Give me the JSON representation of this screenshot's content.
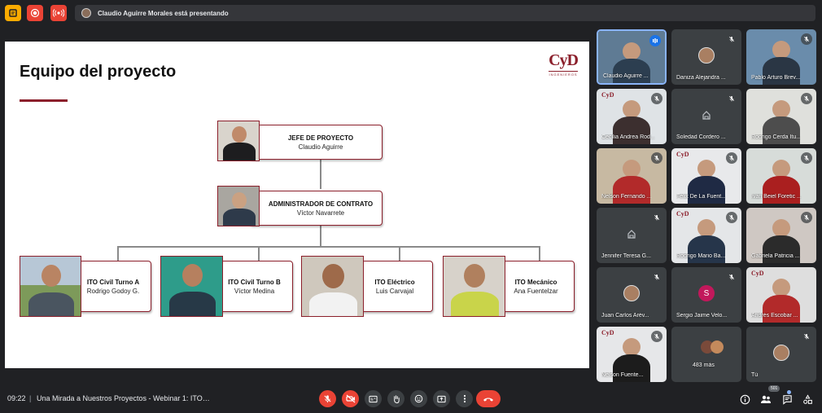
{
  "top_bar": {
    "presenting_text": "Claudio Aguirre Morales está presentando",
    "colors": {
      "hand": "#f9ab00",
      "record": "#ea4335",
      "live": "#ea4335"
    }
  },
  "slide": {
    "title": "Equipo del proyecto",
    "logo": "CyD",
    "logo_sub": "INGENIEROS",
    "accent_color": "#8b1f2b",
    "org": {
      "head": {
        "role": "JEFE DE PROYECTO",
        "name": "Claudio Aguirre"
      },
      "admin": {
        "role": "ADMINISTRADOR DE CONTRATO",
        "name": "Víctor Navarrete"
      },
      "members": [
        {
          "role": "ITO Civil Turno A",
          "name": "Rodrigo Godoy G."
        },
        {
          "role": "ITO Civil Turno B",
          "name": "Víctor Medina"
        },
        {
          "role": "ITO Eléctrico",
          "name": "Luis Carvajal"
        },
        {
          "role": "ITO Mecánico",
          "name": "Ana Fuentelzar"
        }
      ]
    }
  },
  "participants": [
    {
      "name": "Claudio Aguirre ...",
      "mic": "speaking",
      "kind": "video"
    },
    {
      "name": "Daniza Alejandra ...",
      "mic": "muted",
      "kind": "photo"
    },
    {
      "name": "Pablo Arturo Brev...",
      "mic": "muted",
      "kind": "video"
    },
    {
      "name": "Cecilia Andrea Rod...",
      "mic": "muted",
      "kind": "video"
    },
    {
      "name": "Soledad Cordero ...",
      "mic": "muted",
      "kind": "camera-off"
    },
    {
      "name": "Rodrigo Cerda Itu...",
      "mic": "muted",
      "kind": "video"
    },
    {
      "name": "Nelson Fernando ...",
      "mic": "muted",
      "kind": "video"
    },
    {
      "name": "Félix De La Fuent...",
      "mic": "muted",
      "kind": "video"
    },
    {
      "name": "Iván Beiel Foretic ...",
      "mic": "muted",
      "kind": "video"
    },
    {
      "name": "Jennifer Teresa G...",
      "mic": "muted",
      "kind": "camera-off"
    },
    {
      "name": "Rodrigo Mario Ba...",
      "mic": "muted",
      "kind": "video"
    },
    {
      "name": "Gabriela Patricia ...",
      "mic": "muted",
      "kind": "video"
    },
    {
      "name": "Juan Carlos Arév...",
      "mic": "muted",
      "kind": "photo"
    },
    {
      "name": "Sergio Jaime Velo...",
      "mic": "muted",
      "kind": "letter",
      "initial": "S",
      "color": "#c2185b"
    },
    {
      "name": "Andrés Escobar ...",
      "mic": "none",
      "kind": "video"
    },
    {
      "name": "Nelson Fuente...",
      "mic": "muted",
      "kind": "video"
    },
    {
      "name": "483 más",
      "mic": "none",
      "kind": "more"
    },
    {
      "name": "Tú",
      "mic": "muted",
      "kind": "photo"
    }
  ],
  "bottom_bar": {
    "time": "09:22",
    "separator": "|",
    "meeting_title": "Una Mirada a Nuestros Proyectos - Webinar 1: ITO P...",
    "participant_count": "501"
  }
}
